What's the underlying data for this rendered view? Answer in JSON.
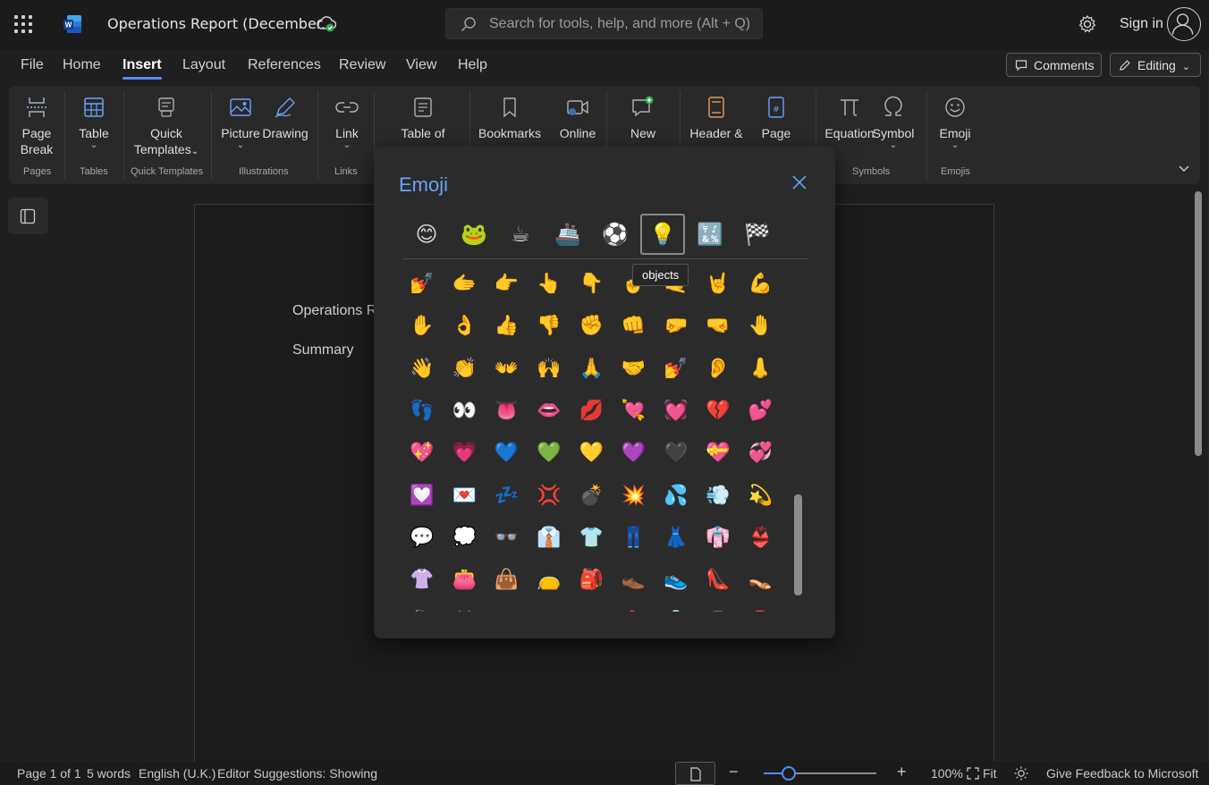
{
  "app": {
    "title": "Operations Report (December...",
    "search_placeholder": "Search for tools, help, and more (Alt + Q)",
    "sign_in": "Sign in",
    "icons": [
      "waffle-icon",
      "word-logo-icon",
      "cloud-saved-icon",
      "search-icon",
      "gear-icon",
      "avatar-icon"
    ]
  },
  "tabs": [
    {
      "label": "File"
    },
    {
      "label": "Home"
    },
    {
      "label": "Insert",
      "active": true
    },
    {
      "label": "Layout"
    },
    {
      "label": "References"
    },
    {
      "label": "Review"
    },
    {
      "label": "View"
    },
    {
      "label": "Help"
    }
  ],
  "toolbar": {
    "comments": "Comments",
    "editing": "Editing"
  },
  "ribbon": {
    "buttons": [
      {
        "line1": "Page",
        "line2": "Break",
        "icon": "page-break-icon"
      },
      {
        "line1": "Table",
        "chevron": "⌄",
        "icon": "table-icon"
      },
      {
        "line1": "Quick",
        "line2": "Templates",
        "chevron": "⌄",
        "icon": "quick-templates-icon"
      },
      {
        "line1": "Picture",
        "chevron": "⌄",
        "icon": "picture-icon"
      },
      {
        "line1": "Drawing",
        "icon": "drawing-icon"
      },
      {
        "line1": "Link",
        "chevron": "⌄",
        "icon": "link-icon"
      },
      {
        "line1": "Table of",
        "icon": "table-of-contents-icon"
      },
      {
        "line1": "Bookmarks",
        "icon": "bookmark-icon"
      },
      {
        "line1": "Online",
        "icon": "online-video-icon"
      },
      {
        "line1": "New",
        "icon": "new-comment-icon"
      },
      {
        "line1": "Header &",
        "icon": "header-footer-icon"
      },
      {
        "line1": "Page",
        "icon": "page-number-icon"
      },
      {
        "line1": "Equation",
        "icon": "equation-icon"
      },
      {
        "line1": "Symbol",
        "chevron": "⌄",
        "icon": "symbol-icon"
      },
      {
        "line1": "Emoji",
        "chevron": "⌄",
        "icon": "emoji-icon"
      }
    ],
    "groups": [
      "Pages",
      "Tables",
      "Quick Templates",
      "Illustrations",
      "Links",
      "Symbols",
      "Emojis"
    ]
  },
  "document": {
    "line1": "Operations R",
    "line2": "Summary"
  },
  "emoji_dialog": {
    "title": "Emoji",
    "tooltip": "objects",
    "categories": [
      {
        "name": "smileys",
        "glyph": "😊"
      },
      {
        "name": "animals",
        "glyph": "🐸"
      },
      {
        "name": "food",
        "glyph": "☕"
      },
      {
        "name": "travel",
        "glyph": "🚢"
      },
      {
        "name": "activities",
        "glyph": "⚽"
      },
      {
        "name": "objects",
        "glyph": "💡",
        "selected": true
      },
      {
        "name": "symbols",
        "glyph": "🔣"
      },
      {
        "name": "flags",
        "glyph": "🏁"
      }
    ],
    "rows": [
      [
        "💅",
        "🫱",
        "👉",
        "👆",
        "👇",
        "🤞",
        "🤙",
        "🤘",
        "💪"
      ],
      [
        "✋",
        "👌",
        "👍",
        "👎",
        "✊",
        "👊",
        "🤛",
        "🤜",
        "🤚"
      ],
      [
        "👋",
        "👏",
        "👐",
        "🙌",
        "🙏",
        "🤝",
        "💅",
        "👂",
        "👃"
      ],
      [
        "👣",
        "👀",
        "👅",
        "👄",
        "💋",
        "💘",
        "💓",
        "💔",
        "💕"
      ],
      [
        "💖",
        "💗",
        "💙",
        "💚",
        "💛",
        "💜",
        "🖤",
        "💝",
        "💞"
      ],
      [
        "💟",
        "💌",
        "💤",
        "💢",
        "💣",
        "💥",
        "💦",
        "💨",
        "💫"
      ],
      [
        "💬",
        "💭",
        "👓",
        "👔",
        "👕",
        "👖",
        "👗",
        "👘",
        "👙"
      ],
      [
        "👚",
        "👛",
        "👜",
        "👝",
        "🎒",
        "👞",
        "👟",
        "👠",
        "👡"
      ],
      [
        "👢",
        "👑",
        "👒",
        "🎩",
        "🎓",
        "💄",
        "💍",
        "💎",
        "🔇"
      ]
    ],
    "scroll_position": 0.72
  },
  "status": {
    "page": "Page 1 of 1",
    "words": "5 words",
    "language": "English (U.K.)",
    "editor": "Editor Suggestions: Showing",
    "zoom": "100%",
    "fit": "Fit",
    "feedback": "Give Feedback to Microsoft",
    "zoom_level": 0.22
  }
}
